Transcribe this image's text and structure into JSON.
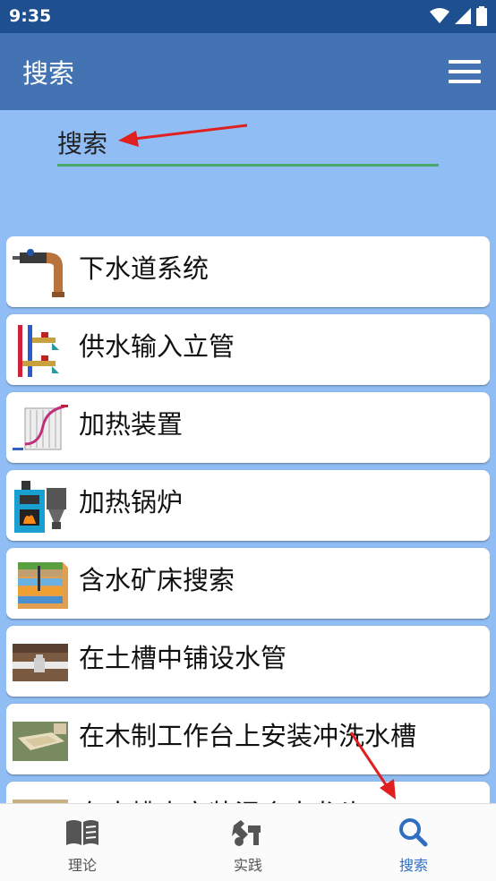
{
  "status_bar": {
    "time": "9:35",
    "icons": [
      "wifi-icon",
      "signal-icon",
      "battery-icon"
    ]
  },
  "app_bar": {
    "title": "搜索",
    "menu_icon": "hamburger-menu-icon"
  },
  "search": {
    "placeholder": "搜索",
    "value": ""
  },
  "items": [
    {
      "label": "下水道系统",
      "icon": "sewer-pipe-icon"
    },
    {
      "label": "供水输入立管",
      "icon": "water-riser-icon"
    },
    {
      "label": "加热装置",
      "icon": "radiator-icon"
    },
    {
      "label": "加热锅炉",
      "icon": "boiler-icon"
    },
    {
      "label": "含水矿床搜索",
      "icon": "aquifer-layers-icon"
    },
    {
      "label": "在土槽中铺设水管",
      "icon": "trench-pipe-icon"
    },
    {
      "label": "在木制工作台上安装冲洗水槽",
      "icon": "sink-icon"
    },
    {
      "label": "在水槽内安装混合水龙头",
      "icon": "faucet-icon"
    }
  ],
  "bottom_nav": [
    {
      "label": "理论",
      "icon": "book-icon",
      "active": false
    },
    {
      "label": "实践",
      "icon": "tools-icon",
      "active": false
    },
    {
      "label": "搜索",
      "icon": "search-icon",
      "active": true
    }
  ],
  "colors": {
    "status_bar": "#1e4f8f",
    "app_bar": "#4373b2",
    "background": "#90bdf4",
    "underline": "#4aa86a",
    "active_nav": "#2f6ec1",
    "annotation_arrow": "#e02020"
  }
}
